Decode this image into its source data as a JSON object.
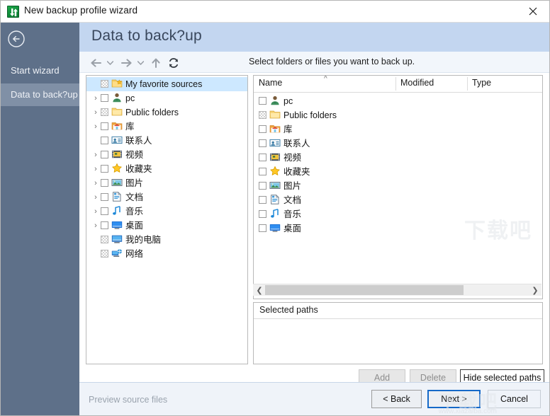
{
  "window": {
    "title": "New backup profile wizard",
    "app_icon": "backup-arrows-icon",
    "close_label": "✕"
  },
  "sidebar": {
    "back_icon": "back-arrow-circle-icon",
    "items": [
      {
        "label": "Start wizard",
        "active": false
      },
      {
        "label": "Data to back?up",
        "active": true
      }
    ]
  },
  "header": {
    "title": "Data to back?up",
    "accent": "#c3d6f0"
  },
  "toolbar": {
    "back_icon": "arrow-left-icon",
    "back_dropdown_icon": "chevron-down-icon",
    "forward_icon": "arrow-right-icon",
    "forward_dropdown_icon": "chevron-down-icon",
    "up_icon": "arrow-up-icon",
    "refresh_icon": "refresh-icon",
    "hint": "Select folders or files you want to back up."
  },
  "tree": {
    "rows": [
      {
        "label": "My favorite sources",
        "icon": "favorites-folder-icon",
        "expander": "",
        "check": "grey",
        "selected": true,
        "indent": 0
      },
      {
        "label": "pc",
        "icon": "user-icon",
        "expander": "›",
        "check": "empty",
        "selected": false,
        "indent": 1
      },
      {
        "label": "Public folders",
        "icon": "folder-icon",
        "expander": "›",
        "check": "grey",
        "selected": false,
        "indent": 1
      },
      {
        "label": "库",
        "icon": "library-icon",
        "expander": "›",
        "check": "empty",
        "selected": false,
        "indent": 1
      },
      {
        "label": "联系人",
        "icon": "contacts-icon",
        "expander": "",
        "check": "empty",
        "selected": false,
        "indent": 1
      },
      {
        "label": "视频",
        "icon": "video-icon",
        "expander": "›",
        "check": "empty",
        "selected": false,
        "indent": 1
      },
      {
        "label": "收藏夹",
        "icon": "star-icon",
        "expander": "›",
        "check": "empty",
        "selected": false,
        "indent": 1
      },
      {
        "label": "图片",
        "icon": "pictures-icon",
        "expander": "›",
        "check": "empty",
        "selected": false,
        "indent": 1
      },
      {
        "label": "文档",
        "icon": "documents-icon",
        "expander": "›",
        "check": "empty",
        "selected": false,
        "indent": 1
      },
      {
        "label": "音乐",
        "icon": "music-icon",
        "expander": "›",
        "check": "empty",
        "selected": false,
        "indent": 1
      },
      {
        "label": "桌面",
        "icon": "desktop-icon",
        "expander": "›",
        "check": "empty",
        "selected": false,
        "indent": 1
      },
      {
        "label": "我的电脑",
        "icon": "computer-icon",
        "expander": "",
        "check": "grey",
        "selected": false,
        "indent": 0
      },
      {
        "label": "网络",
        "icon": "network-icon",
        "expander": "",
        "check": "grey",
        "selected": false,
        "indent": 0
      }
    ]
  },
  "list": {
    "columns": [
      "Name",
      "Modified",
      "Type"
    ],
    "sort_caret_icon": "sort-ascending-caret-icon",
    "rows": [
      {
        "label": "pc",
        "icon": "user-icon",
        "check": "empty",
        "modified": "",
        "type": ""
      },
      {
        "label": "Public folders",
        "icon": "folder-icon",
        "check": "grey",
        "modified": "",
        "type": ""
      },
      {
        "label": "库",
        "icon": "library-icon",
        "check": "empty",
        "modified": "",
        "type": ""
      },
      {
        "label": "联系人",
        "icon": "contacts-icon",
        "check": "empty",
        "modified": "",
        "type": ""
      },
      {
        "label": "视频",
        "icon": "video-icon",
        "check": "empty",
        "modified": "",
        "type": ""
      },
      {
        "label": "收藏夹",
        "icon": "star-icon",
        "check": "empty",
        "modified": "",
        "type": ""
      },
      {
        "label": "图片",
        "icon": "pictures-icon",
        "check": "empty",
        "modified": "",
        "type": ""
      },
      {
        "label": "文档",
        "icon": "documents-icon",
        "check": "empty",
        "modified": "",
        "type": ""
      },
      {
        "label": "音乐",
        "icon": "music-icon",
        "check": "empty",
        "modified": "",
        "type": ""
      },
      {
        "label": "桌面",
        "icon": "desktop-icon",
        "check": "empty",
        "modified": "",
        "type": ""
      }
    ]
  },
  "hscroll": {
    "left_icon": "scroll-left-icon",
    "right_icon": "scroll-right-icon"
  },
  "selected_paths": {
    "header": "Selected paths",
    "rows": []
  },
  "actions": {
    "add": {
      "label": "Add",
      "enabled": false
    },
    "delete": {
      "label": "Delete",
      "enabled": false
    },
    "hide": {
      "label": "Hide selected paths",
      "enabled": true
    }
  },
  "footer": {
    "preview_label": "Preview source files",
    "back_label": "< Back",
    "next_label": "Next >",
    "cancel_label": "Cancel"
  },
  "watermark": {
    "logo": "下载吧",
    "url": "www.xiazaiba.com"
  }
}
